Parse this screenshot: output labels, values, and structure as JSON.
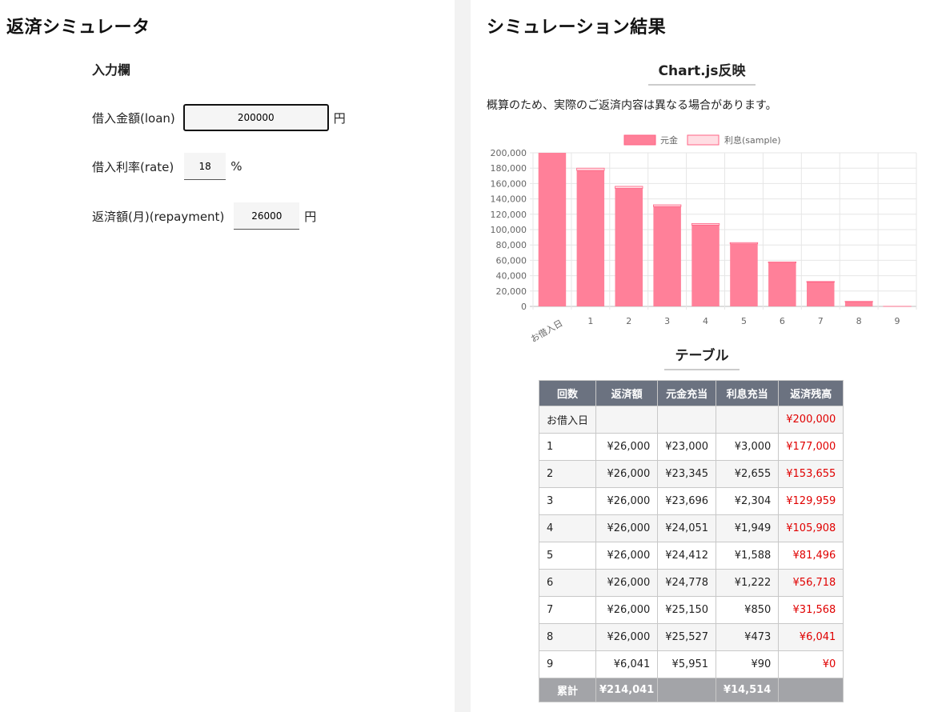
{
  "left": {
    "title": "返済シミュレータ",
    "input_title": "入力欄",
    "loan": {
      "label": "借入金額(loan)",
      "value": "200000",
      "unit": "円"
    },
    "rate": {
      "label": "借入利率(rate)",
      "value": "18",
      "unit": "%"
    },
    "repayment": {
      "label": "返済額(月)(repayment)",
      "value": "26000",
      "unit": "円"
    }
  },
  "right": {
    "title": "シミュレーション結果",
    "chart_heading": "Chart.js反映",
    "note": "概算のため、実際のご返済内容は異なる場合があります。",
    "table_heading": "テーブル"
  },
  "colors": {
    "principal": "#ff8099",
    "interest": "#ffdde3",
    "principal_border": "#ff6384"
  },
  "chart_data": {
    "type": "bar",
    "categories": [
      "お借入日",
      "1",
      "2",
      "3",
      "4",
      "5",
      "6",
      "7",
      "8",
      "9"
    ],
    "series": [
      {
        "name": "元金",
        "values": [
          200000,
          177000,
          153655,
          129959,
          105908,
          81496,
          56718,
          31568,
          6041,
          0
        ]
      },
      {
        "name": "利息(sample)",
        "values": [
          0,
          3000,
          2655,
          2304,
          1949,
          1588,
          1222,
          850,
          473,
          90
        ]
      }
    ],
    "stacked": true,
    "ylim": [
      0,
      200000
    ],
    "yticks": [
      "0",
      "20,000",
      "40,000",
      "60,000",
      "80,000",
      "100,000",
      "120,000",
      "140,000",
      "160,000",
      "180,000",
      "200,000"
    ],
    "legend": "top",
    "grid": true
  },
  "table": {
    "headers": [
      "回数",
      "返済額",
      "元金充当",
      "利息充当",
      "返済残高"
    ],
    "rows": [
      [
        "お借入日",
        "",
        "",
        "",
        "¥200,000"
      ],
      [
        "1",
        "¥26,000",
        "¥23,000",
        "¥3,000",
        "¥177,000"
      ],
      [
        "2",
        "¥26,000",
        "¥23,345",
        "¥2,655",
        "¥153,655"
      ],
      [
        "3",
        "¥26,000",
        "¥23,696",
        "¥2,304",
        "¥129,959"
      ],
      [
        "4",
        "¥26,000",
        "¥24,051",
        "¥1,949",
        "¥105,908"
      ],
      [
        "5",
        "¥26,000",
        "¥24,412",
        "¥1,588",
        "¥81,496"
      ],
      [
        "6",
        "¥26,000",
        "¥24,778",
        "¥1,222",
        "¥56,718"
      ],
      [
        "7",
        "¥26,000",
        "¥25,150",
        "¥850",
        "¥31,568"
      ],
      [
        "8",
        "¥26,000",
        "¥25,527",
        "¥473",
        "¥6,041"
      ],
      [
        "9",
        "¥6,041",
        "¥5,951",
        "¥90",
        "¥0"
      ]
    ],
    "total": [
      "累計",
      "¥214,041",
      "",
      "¥14,514",
      ""
    ]
  }
}
